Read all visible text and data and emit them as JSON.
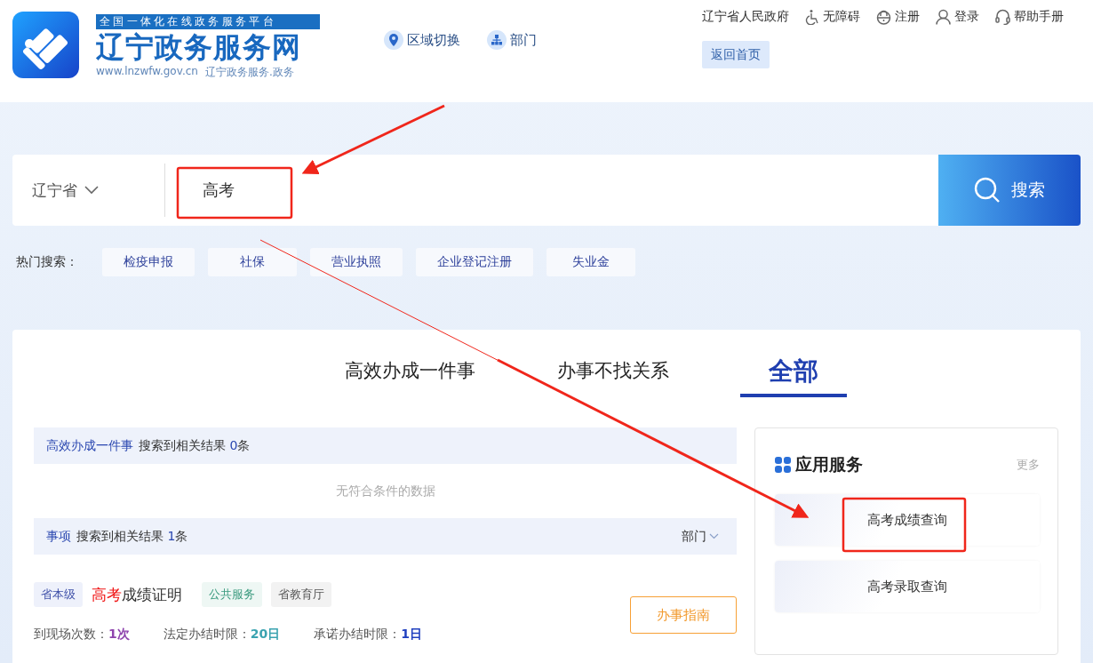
{
  "header": {
    "platform_slogan": "全国一体化在线政务服务平台",
    "site_name": "辽宁政务服务网",
    "domain": "www.lnzwfw.gov.cn",
    "domain_alt": "辽宁政务服务.政务",
    "nav": [
      {
        "kind": "region",
        "label": "区域切换"
      },
      {
        "kind": "department",
        "label": "部门"
      }
    ],
    "top_links": [
      {
        "kind": "text",
        "label": "辽宁省人民政府"
      },
      {
        "kind": "accessibility",
        "label": "无障碍"
      },
      {
        "kind": "register",
        "label": "注册"
      },
      {
        "kind": "login",
        "label": "登录"
      },
      {
        "kind": "help",
        "label": "帮助手册"
      }
    ],
    "home_button": "返回首页"
  },
  "search": {
    "region": "辽宁省",
    "value": "高考",
    "button": "搜索"
  },
  "hot_search": {
    "label": "热门搜索：",
    "items": [
      "检疫申报",
      "社保",
      "营业执照",
      "企业登记注册",
      "失业金"
    ]
  },
  "tabs": [
    {
      "label": "高效办成一件事",
      "selected": false
    },
    {
      "label": "办事不找关系",
      "selected": false
    },
    {
      "label": "全部",
      "selected": true
    }
  ],
  "results": [
    {
      "category": "高效办成一件事",
      "prefix": "搜索到相关结果",
      "count": "0",
      "suffix": "条",
      "empty_message": "无符合条件的数据"
    },
    {
      "category": "事项",
      "prefix": "搜索到相关结果",
      "count": "1",
      "suffix": "条",
      "filter": "部门"
    }
  ],
  "service_item": {
    "tags_before": [
      {
        "kind": "level",
        "label": "省本级"
      }
    ],
    "title_highlight": "高考",
    "title_rest": "成绩证明",
    "tags_after": [
      {
        "kind": "category",
        "label": "公共服务"
      },
      {
        "kind": "department",
        "label": "省教育厅"
      }
    ],
    "stats": [
      {
        "label": "到现场次数：",
        "value": "1次",
        "color": "#8e44ad"
      },
      {
        "label": "法定办结时限：",
        "value": "20日",
        "color": "#3aa3b0"
      },
      {
        "label": "承诺办结时限：",
        "value": "1日",
        "color": "#1f3fbf"
      }
    ],
    "guide_button": "办事指南"
  },
  "app_services": {
    "title": "应用服务",
    "more": "更多",
    "items": [
      "高考成绩查询",
      "高考录取查询"
    ]
  }
}
